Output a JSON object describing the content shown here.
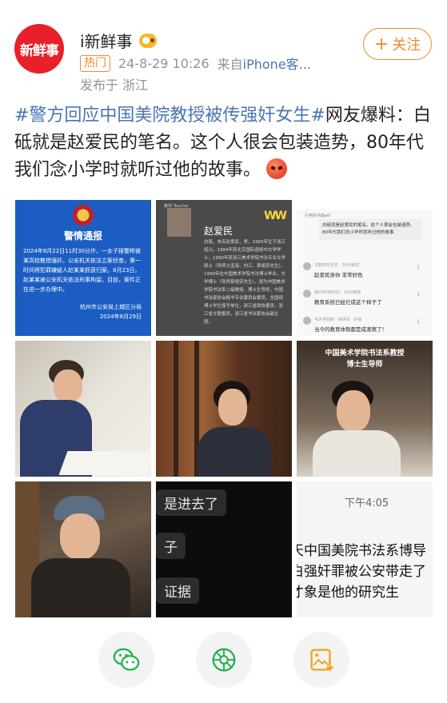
{
  "author": {
    "avatar_text": "新鲜事",
    "name": "i新鲜事",
    "badge_icon": "vip-badge-icon",
    "hot_label": "热门",
    "timestamp": "24-8-29 10:26",
    "source_prefix": "来自",
    "source_device": "iPhone客...",
    "location": "发布于 浙江",
    "follow_label": "关注"
  },
  "post": {
    "topic": "#警方回应中国美院教授被传强奸女生#",
    "body": "网友爆料：白砥就是赵爱民的笔名。这个人很会包装造势，80年代我们念小学时就听过他的故事。"
  },
  "images": {
    "notice": {
      "title": "警情通报",
      "body": "2024年8月22日11时30分许，一女子报警称被某高校教授强奸。公安机关依法立案侦查，第一时间将犯罪嫌疑人赵某某抓获归案。8月23日，赵某某被公安机关依法刑事拘留。目前，案件正在进一步办理中。",
      "signature": "杭州市公安局上城区分局",
      "date": "2024年8月29日"
    },
    "profile": {
      "label": "教师 Teacher",
      "logo": "WW",
      "name": "赵爱民",
      "text": "白砥，本名赵爱民，男，1965年生于浙江绍兴。1984年获北京国际函授中文学学士，1990年获浙江美术学院书法专业文学硕士（导师沙孟海，刘江，章祖安先生）。1999年在中国美术学院书法博士毕业，文学博士（导师章祖安先生）。现为中国美术学院书法系二级教授、博士生导师，中国书法家协会楷书专业委员会委员，全国硕博士学位授予单位，浙江省政协委员，浙江省文联委员，浙江省书法家协会副主席。"
    },
    "comments": {
      "reply_label": "引用的书面w0",
      "reply_text": "白砥就是赵爱民的笔名。这个人很会包装造势，80年代我们念小学时就听过他的故事",
      "items": [
        {
          "user": "华数可乐万岁 · 30分钟前",
          "text": "赵爱民诶你 非常好色",
          "likes": "1"
        },
        {
          "user": "用户6658831 · 18分钟前",
          "text": "教育系统已经烂成这个样子了",
          "likes": "1"
        },
        {
          "user": "与大学回到 · 好评论 · 护房",
          "text": "当今的教育体制都是成滚窝了！",
          "likes": "1"
        }
      ]
    },
    "video_caption": [
      "中国美术学院书法系教授",
      "博士生导师"
    ],
    "chat": [
      "是进去了",
      "子",
      "证据"
    ],
    "screenshot_news": {
      "time": "下午4:05",
      "lines": [
        "天中国美院书法系博导",
        "白强奸罪被公安带走了",
        "才象是他的研究生"
      ]
    }
  },
  "actions": [
    {
      "name": "wechat-share-button",
      "icon": "wechat-icon"
    },
    {
      "name": "moments-share-button",
      "icon": "moments-icon"
    },
    {
      "name": "save-image-button",
      "icon": "save-image-icon"
    }
  ]
}
